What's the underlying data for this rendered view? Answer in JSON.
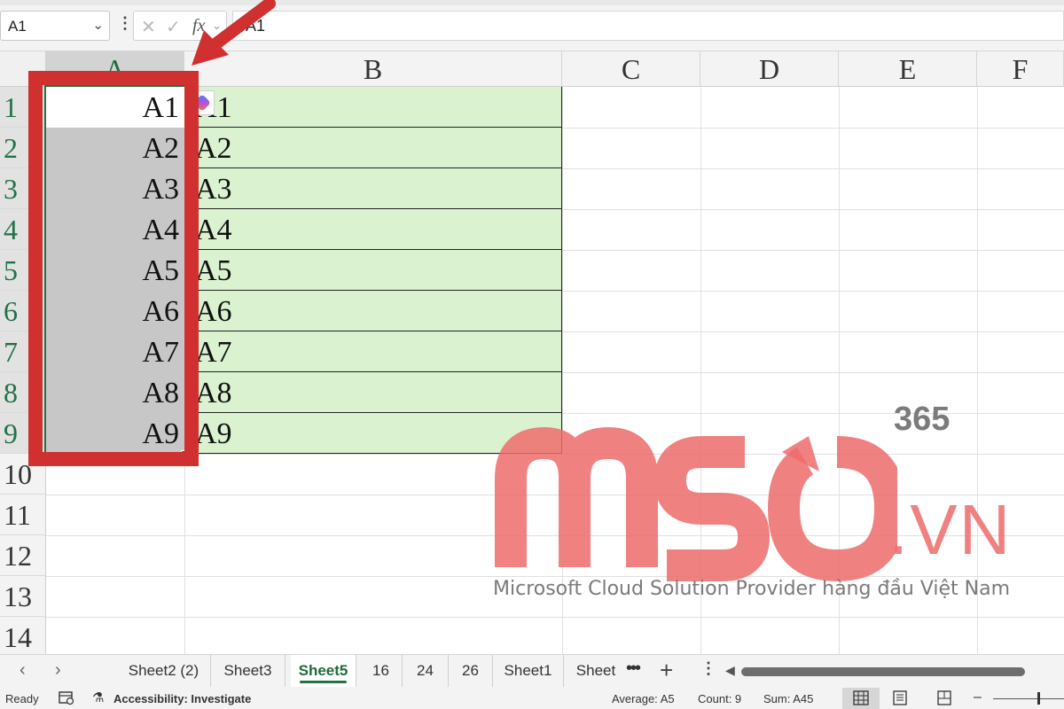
{
  "formula_bar": {
    "name_box": "A1",
    "formula_value": "A1"
  },
  "columns": [
    "A",
    "B",
    "C",
    "D",
    "E",
    "F"
  ],
  "rows": [
    "1",
    "2",
    "3",
    "4",
    "5",
    "6",
    "7",
    "8",
    "9",
    "10",
    "11",
    "12",
    "13",
    "14"
  ],
  "cells_a": [
    "A1",
    "A2",
    "A3",
    "A4",
    "A5",
    "A6",
    "A7",
    "A8",
    "A9"
  ],
  "cells_b": [
    "A1",
    "A2",
    "A3",
    "A4",
    "A5",
    "A6",
    "A7",
    "A8",
    "A9"
  ],
  "watermark": {
    "brand": "MSO",
    "superscript": "365",
    "domain": ".VN",
    "tagline": "Microsoft Cloud Solution Provider hàng đầu Việt Nam"
  },
  "sheet_tabs": [
    "Sheet2 (2)",
    "Sheet3",
    "Sheet5",
    "16",
    "24",
    "26",
    "Sheet1",
    "Sheet"
  ],
  "active_tab": "Sheet5",
  "status": {
    "ready": "Ready",
    "accessibility": "Accessibility: Investigate",
    "average": "Average: A5",
    "count": "Count: 9",
    "sum": "Sum: A45"
  },
  "colors": {
    "excel_green": "#217346",
    "annotation_red": "#d0302f",
    "range_fill": "#daf2d0",
    "selection_gray": "#c7c7c7",
    "watermark_red": "#ee6c6c"
  }
}
